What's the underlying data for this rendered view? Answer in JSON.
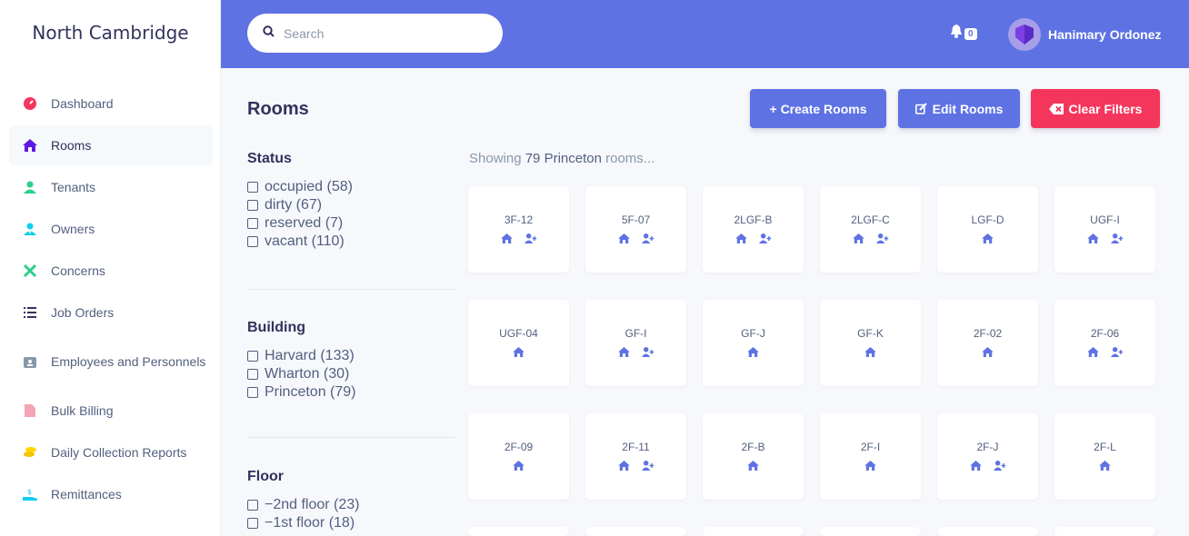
{
  "brand": "North Cambridge",
  "sidebar": {
    "items": [
      {
        "label": "Dashboard",
        "icon": "dashboard-gauge-icon",
        "color": "#f5365c"
      },
      {
        "label": "Rooms",
        "icon": "home-icon",
        "color": "#5e1ae4"
      },
      {
        "label": "Tenants",
        "icon": "user-icon",
        "color": "#2dce89"
      },
      {
        "label": "Owners",
        "icon": "user-tie-icon",
        "color": "#11cdef"
      },
      {
        "label": "Concerns",
        "icon": "tools-icon",
        "color": "#2dce89"
      },
      {
        "label": "Job Orders",
        "icon": "list-icon",
        "color": "#32325d"
      },
      {
        "label": "Employees and Personnels",
        "icon": "id-badge-icon",
        "color": "#8898aa"
      },
      {
        "label": "Bulk Billing",
        "icon": "file-invoice-icon",
        "color": "#f3a4b5"
      },
      {
        "label": "Daily Collection Reports",
        "icon": "coins-icon",
        "color": "#ffd600"
      },
      {
        "label": "Remittances",
        "icon": "hand-money-icon",
        "color": "#11cdef"
      }
    ]
  },
  "topbar": {
    "search_placeholder": "Search",
    "notification_count": "0",
    "user_name": "Hanimary Ordonez"
  },
  "main": {
    "title": "Rooms",
    "buttons": {
      "create": "+ Create Rooms",
      "edit": "Edit Rooms",
      "clear": "Clear Filters"
    },
    "showing_prefix": "Showing",
    "showing_count": "79 Princeton",
    "showing_suffix": "rooms..."
  },
  "filters": {
    "status": {
      "heading": "Status",
      "options": [
        "occupied (58)",
        "dirty (67)",
        "reserved (7)",
        "vacant (110)"
      ]
    },
    "building": {
      "heading": "Building",
      "options": [
        "Harvard (133)",
        "Wharton (30)",
        "Princeton (79)"
      ]
    },
    "floor": {
      "heading": "Floor",
      "options": [
        "−2nd floor (23)",
        "−1st floor (18)"
      ]
    }
  },
  "rooms": [
    {
      "name": "3F-12",
      "add_tenant": true
    },
    {
      "name": "5F-07",
      "add_tenant": true
    },
    {
      "name": "2LGF-B",
      "add_tenant": true
    },
    {
      "name": "2LGF-C",
      "add_tenant": true
    },
    {
      "name": "LGF-D",
      "add_tenant": false
    },
    {
      "name": "UGF-I",
      "add_tenant": true
    },
    {
      "name": "UGF-04",
      "add_tenant": false
    },
    {
      "name": "GF-I",
      "add_tenant": true
    },
    {
      "name": "GF-J",
      "add_tenant": false
    },
    {
      "name": "GF-K",
      "add_tenant": false
    },
    {
      "name": "2F-02",
      "add_tenant": false
    },
    {
      "name": "2F-06",
      "add_tenant": true
    },
    {
      "name": "2F-09",
      "add_tenant": false
    },
    {
      "name": "2F-11",
      "add_tenant": true
    },
    {
      "name": "2F-B",
      "add_tenant": false
    },
    {
      "name": "2F-I",
      "add_tenant": false
    },
    {
      "name": "2F-J",
      "add_tenant": true
    },
    {
      "name": "2F-L",
      "add_tenant": false
    }
  ],
  "colors": {
    "primary": "#5e72e4",
    "danger": "#f5365c"
  }
}
